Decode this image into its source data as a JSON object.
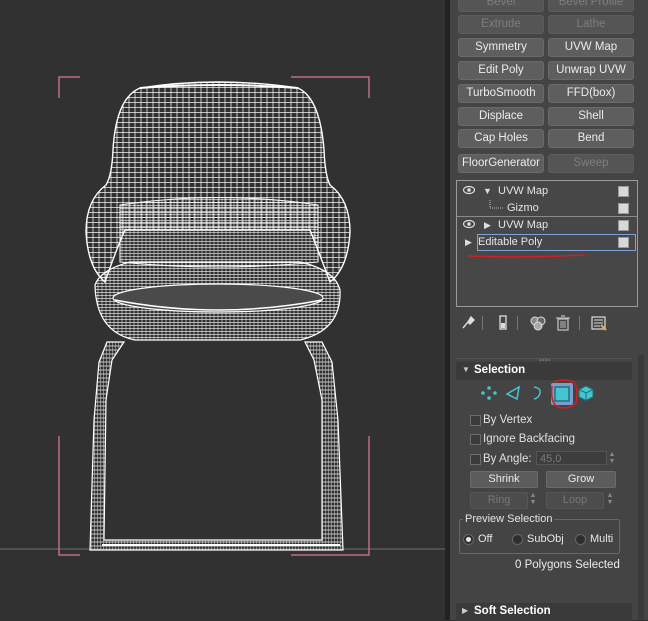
{
  "modifier_buttons": [
    {
      "label": "Bevel",
      "enabled": false
    },
    {
      "label": "Bevel Profile",
      "enabled": false
    },
    {
      "label": "Extrude",
      "enabled": false
    },
    {
      "label": "Lathe",
      "enabled": false
    },
    {
      "label": "Symmetry",
      "enabled": true
    },
    {
      "label": "UVW Map",
      "enabled": true
    },
    {
      "label": "Edit Poly",
      "enabled": true
    },
    {
      "label": "Unwrap UVW",
      "enabled": true
    },
    {
      "label": "TurboSmooth",
      "enabled": true
    },
    {
      "label": "FFD(box)",
      "enabled": true
    },
    {
      "label": "Displace",
      "enabled": true
    },
    {
      "label": "Shell",
      "enabled": true
    },
    {
      "label": "Cap Holes",
      "enabled": true
    },
    {
      "label": "Bend",
      "enabled": true
    },
    {
      "label": "FloorGenerator",
      "enabled": true
    },
    {
      "label": "Sweep",
      "enabled": false
    }
  ],
  "modifier_stack": [
    {
      "label": "UVW Map",
      "expanded": true,
      "visible": true
    },
    {
      "label": "Gizmo",
      "sub": true
    },
    {
      "label": "UVW Map",
      "expanded": false,
      "visible": true
    },
    {
      "label": "Editable Poly",
      "selected": true
    }
  ],
  "stack_tools": [
    "pin-stack-icon",
    "show-end-result-icon",
    "make-unique-icon",
    "remove-modifier-icon",
    "configure-modifier-sets-icon"
  ],
  "selection": {
    "title": "Selection",
    "subobject_icons": [
      "vertex-icon",
      "edge-icon",
      "border-icon",
      "polygon-icon",
      "element-icon"
    ],
    "active_subobject": "polygon",
    "by_vertex": "By Vertex",
    "ignore_backfacing": "Ignore Backfacing",
    "by_angle": "By Angle:",
    "angle_value": "45,0",
    "shrink": "Shrink",
    "grow": "Grow",
    "ring": "Ring",
    "loop": "Loop",
    "preview_title": "Preview Selection",
    "preview_off": "Off",
    "preview_subobj": "SubObj",
    "preview_multi": "Multi",
    "preview_selected": "Off",
    "status": "0 Polygons Selected"
  },
  "soft_selection": {
    "title": "Soft Selection"
  },
  "colors": {
    "viewport_bg": "#313131",
    "panel_bg": "#444444",
    "wireframe": "#ffffff",
    "viewport_brackets": "#e07a9a",
    "annotation_red": "#d02020",
    "polygon_active": "#43c6cf"
  }
}
